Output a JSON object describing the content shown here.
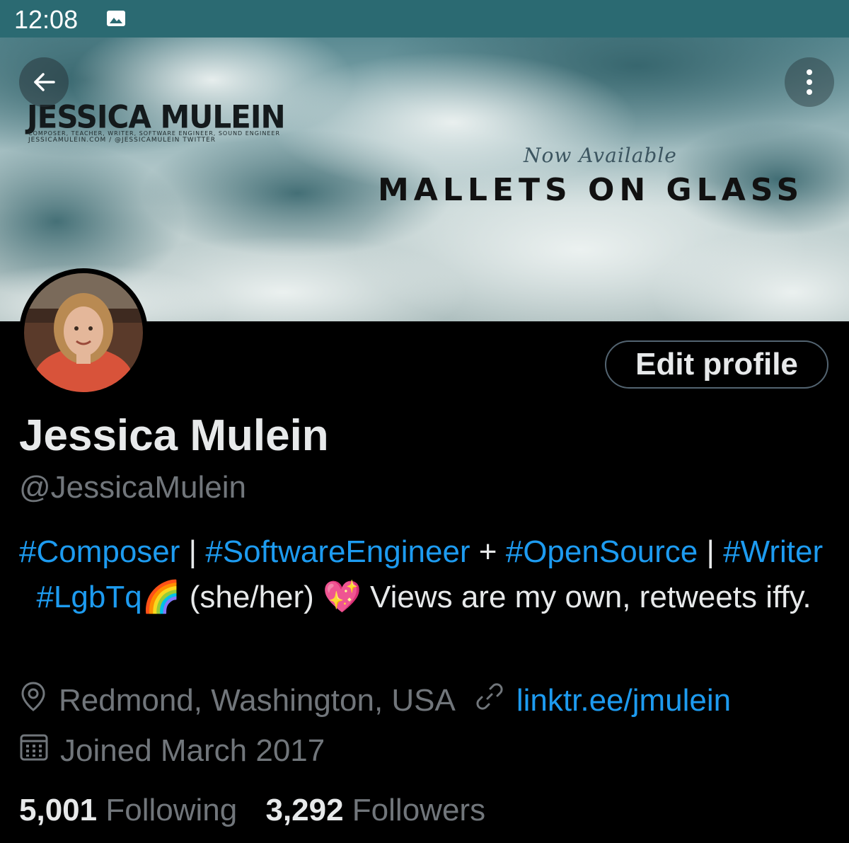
{
  "status_bar": {
    "time": "12:08"
  },
  "banner": {
    "brand_title": "JESSICA MULEIN",
    "brand_subtitle": "COMPOSER, TEACHER, WRITER, SOFTWARE ENGINEER, SOUND ENGINEER",
    "brand_links": "JESSICAMULEIN.COM / @JESSICAMULEIN TWITTER",
    "tagline": "Now Available",
    "album_title": "MALLETS ON GLASS"
  },
  "profile": {
    "edit_button": "Edit profile",
    "display_name": "Jessica Mulein",
    "handle": "@JessicaMulein",
    "bio": {
      "tag1": "#Composer",
      "sep1": " | ",
      "tag2": "#SoftwareEngineer",
      "sep2": " + ",
      "tag3": "#OpenSource",
      "sep3": " | ",
      "tag4": "#Writer",
      "sep4": "  ",
      "tag5": "#LgbTq",
      "rainbow": "🌈",
      "pronouns": " (she/her) ",
      "heart": "💖",
      "rest": " Views are my own, retweets iffy."
    },
    "location": "Redmond, Washington, USA",
    "website": "linktr.ee/jmulein",
    "joined": "Joined March 2017",
    "following_count": "5,001",
    "following_label": "Following",
    "followers_count": "3,292",
    "followers_label": "Followers"
  }
}
